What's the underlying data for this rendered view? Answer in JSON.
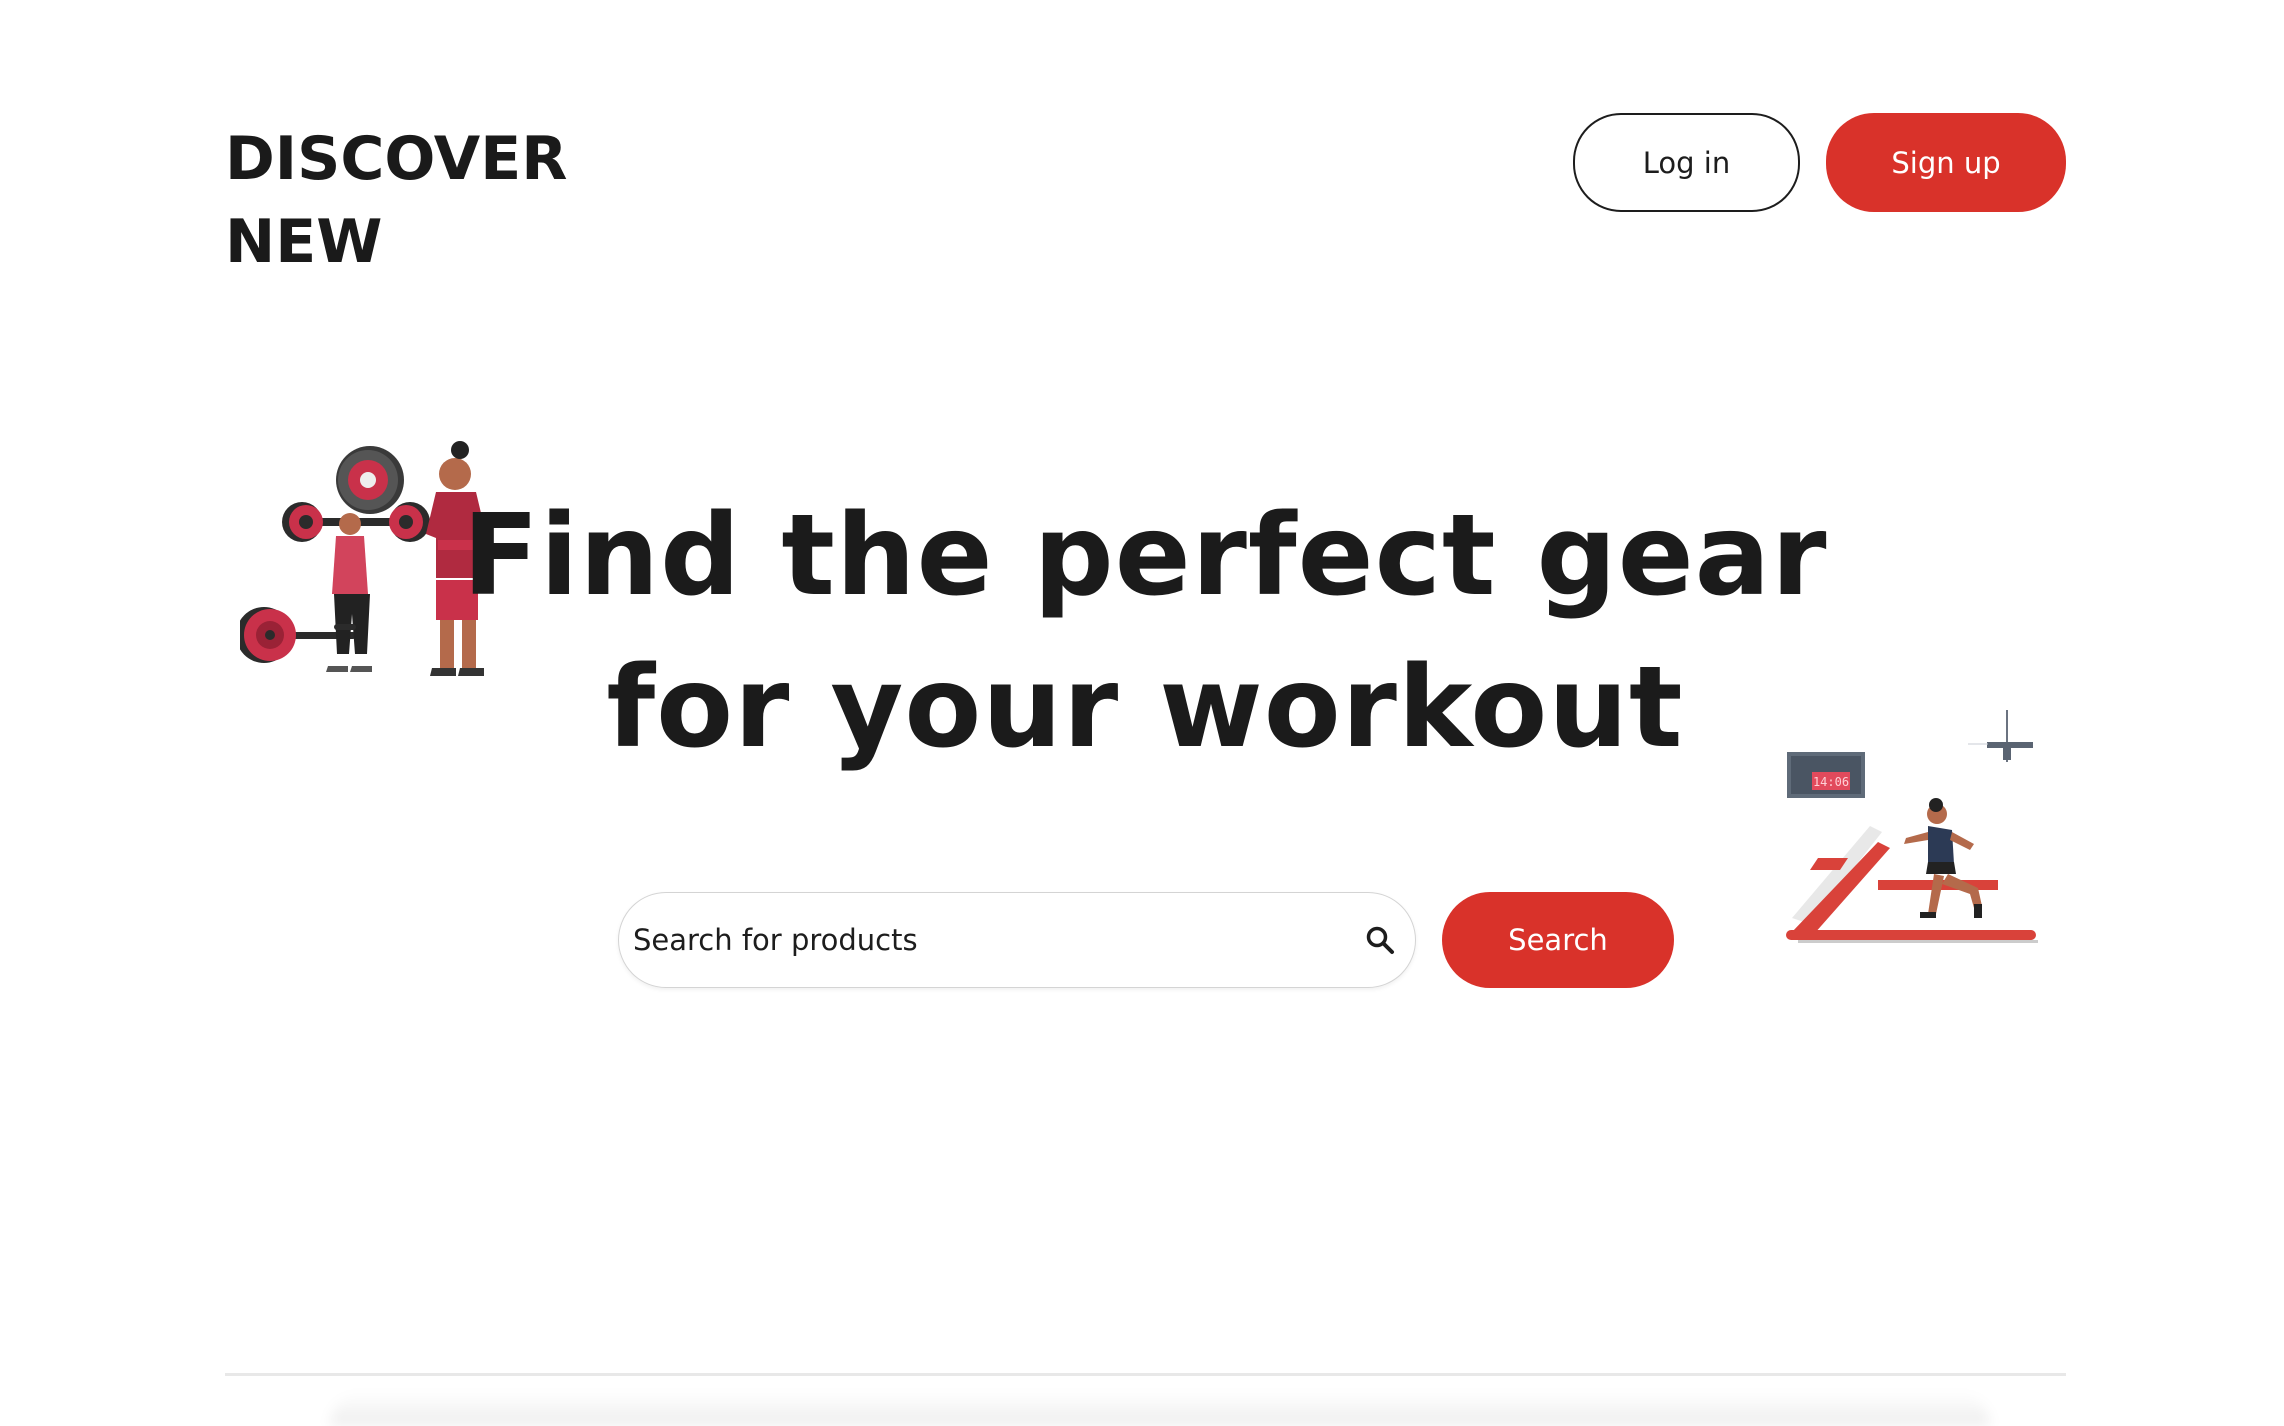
{
  "header": {
    "logo_line1": "DISCOVER",
    "logo_line2": "NEW",
    "login_label": "Log in",
    "signup_label": "Sign up"
  },
  "hero": {
    "headline_line1": "Find the perfect gear",
    "headline_line2": "for your workout"
  },
  "search": {
    "placeholder": "Search for products",
    "button_label": "Search",
    "icon": "search-icon"
  },
  "illustrations": {
    "left": "weightlifting-couple-illustration",
    "right": "treadmill-runner-illustration",
    "treadmill_display_text": "14:06"
  },
  "colors": {
    "accent": "#d9322a",
    "text": "#1d1d1d",
    "background": "#ffffff"
  }
}
